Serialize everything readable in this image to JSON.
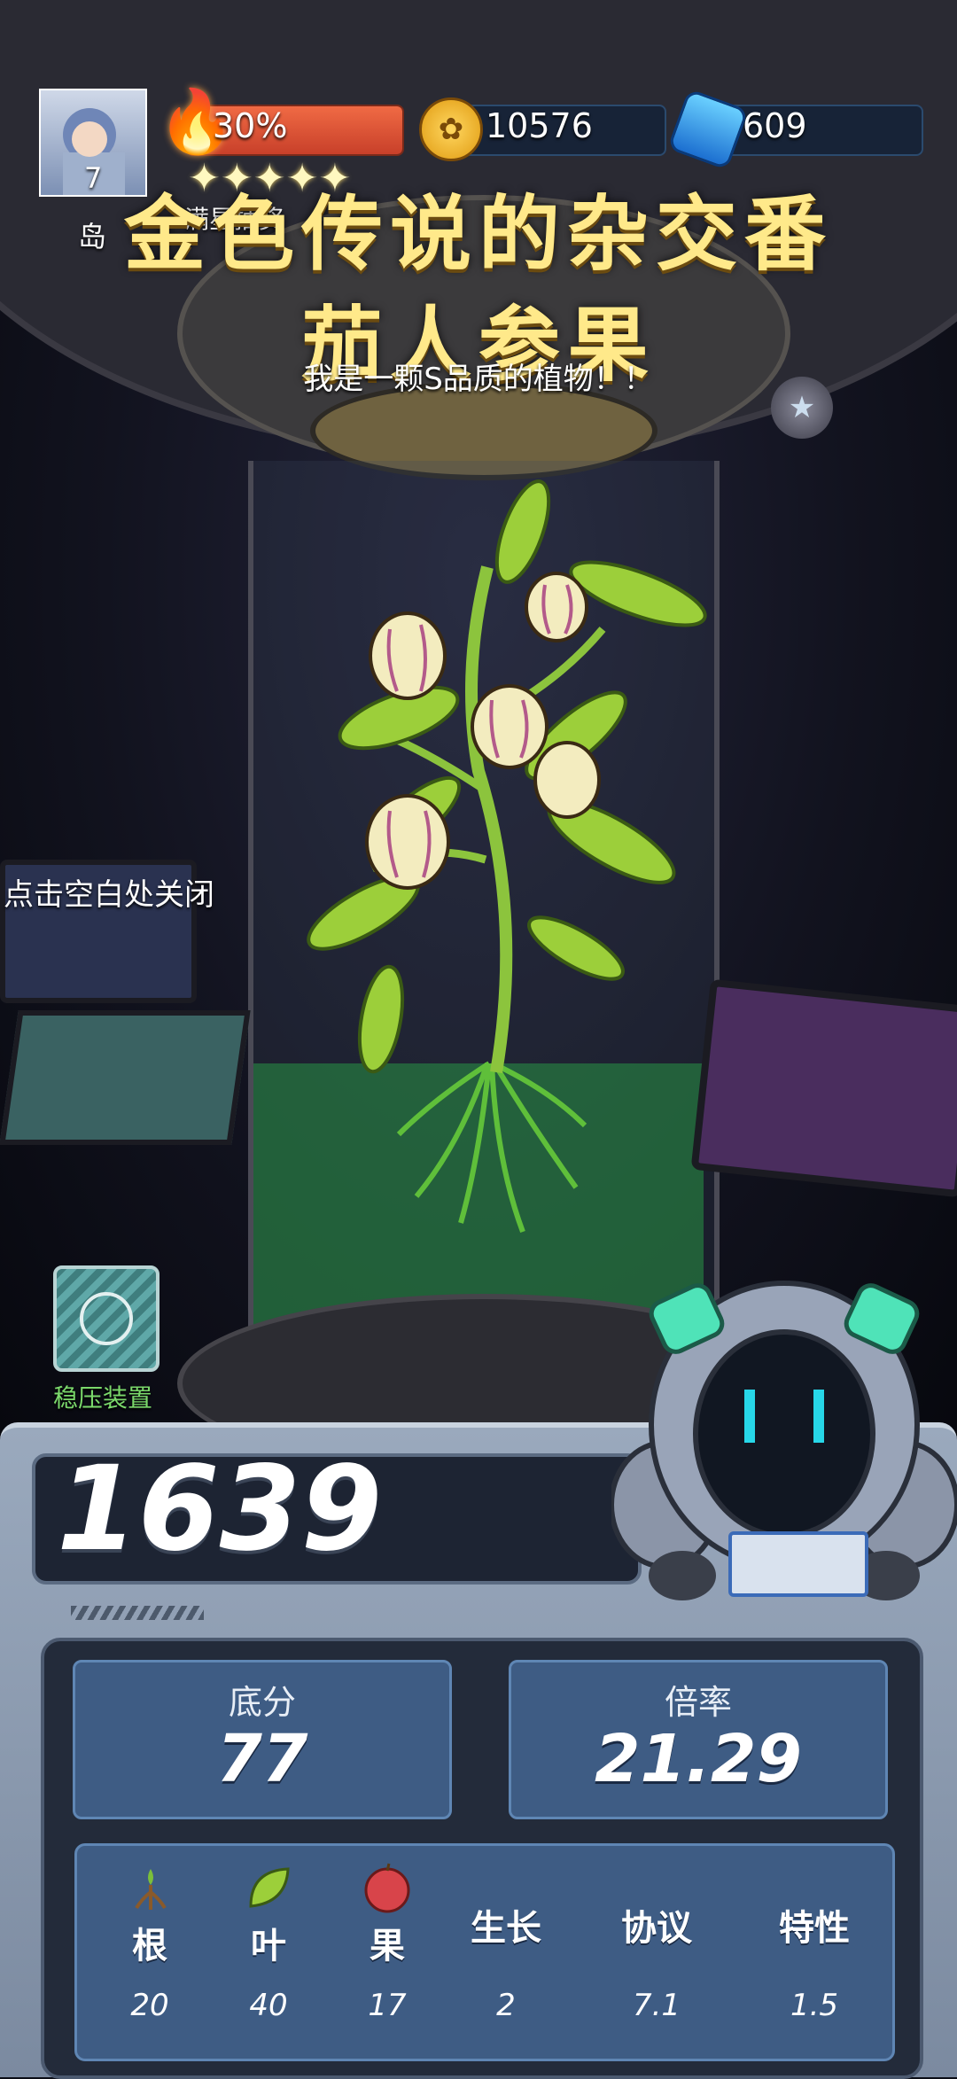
{
  "hud": {
    "player_level": "7",
    "island_label": "岛",
    "energy_percent": "30%",
    "energy_fill": 0.3,
    "coins": "10576",
    "gems": "609",
    "stars_label": "满星抽奖",
    "star_count": 5
  },
  "plant": {
    "title_line1": "金色传说的杂交番",
    "title_line2": "茄人参果",
    "subtitle": "我是一颗S品质的植物！！",
    "close_hint": "点击空白处关闭",
    "device_label": "稳压装置"
  },
  "result": {
    "total_score": "1639",
    "base_score_label": "底分",
    "base_score": "77",
    "multiplier_label": "倍率",
    "multiplier": "21.29"
  },
  "breakdown": {
    "columns": [
      {
        "label": "根",
        "value": "20",
        "icon": "root-icon"
      },
      {
        "label": "叶",
        "value": "40",
        "icon": "leaf-icon"
      },
      {
        "label": "果",
        "value": "17",
        "icon": "fruit-icon"
      },
      {
        "label": "生长",
        "value": "2",
        "icon": ""
      },
      {
        "label": "协议",
        "value": "7.1",
        "icon": ""
      },
      {
        "label": "特性",
        "value": "1.5",
        "icon": ""
      }
    ]
  },
  "colors": {
    "title": "#ffe98a",
    "energy": "#e25a3c",
    "coin": "#f5b82e",
    "gem": "#3aa0f0",
    "panel": "#3e5c84"
  }
}
